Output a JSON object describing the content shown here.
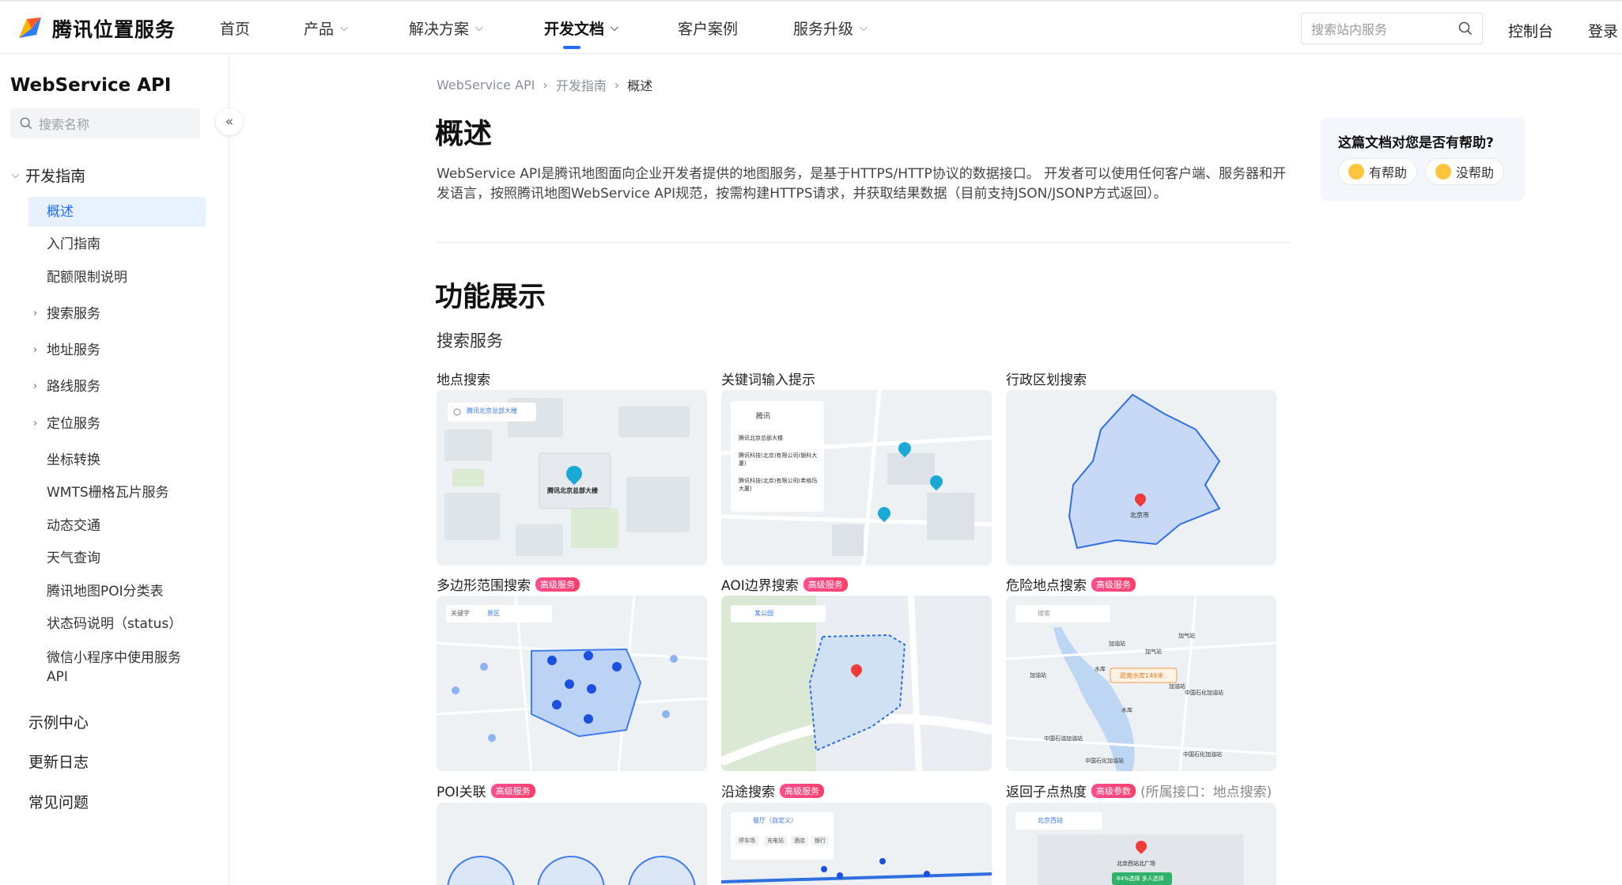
{
  "brand": {
    "name": "腾讯位置服务"
  },
  "nav": {
    "items": [
      {
        "label": "首页",
        "dropdown": false
      },
      {
        "label": "产品",
        "dropdown": true
      },
      {
        "label": "解决方案",
        "dropdown": true
      },
      {
        "label": "开发文档",
        "dropdown": true,
        "active": true
      },
      {
        "label": "客户案例",
        "dropdown": false
      },
      {
        "label": "服务升级",
        "dropdown": true
      }
    ],
    "search_placeholder": "搜索站内服务",
    "console": "控制台",
    "login": "登录"
  },
  "sidebar": {
    "title": "WebService API",
    "search_placeholder": "搜索名称",
    "group": "开发指南",
    "items": [
      {
        "label": "概述",
        "active": true
      },
      {
        "label": "入门指南"
      },
      {
        "label": "配额限制说明"
      },
      {
        "label": "搜索服务",
        "expandable": true
      },
      {
        "label": "地址服务",
        "expandable": true
      },
      {
        "label": "路线服务",
        "expandable": true
      },
      {
        "label": "定位服务",
        "expandable": true
      },
      {
        "label": "坐标转换"
      },
      {
        "label": "WMTS栅格瓦片服务"
      },
      {
        "label": "动态交通"
      },
      {
        "label": "天气查询"
      },
      {
        "label": "腾讯地图POI分类表"
      },
      {
        "label": "状态码说明（status）"
      },
      {
        "label": "微信小程序中使用服务API"
      }
    ],
    "top_links": [
      "示例中心",
      "更新日志",
      "常见问题"
    ]
  },
  "breadcrumb": [
    "WebService API",
    "开发指南",
    "概述"
  ],
  "page": {
    "title": "概述",
    "intro": "WebService API是腾讯地图面向企业开发者提供的地图服务，是基于HTTPS/HTTP协议的数据接口。 开发者可以使用任何客户端、服务器和开发语言，按照腾讯地图WebService API规范，按需构建HTTPS请求，并获取结果数据（目前支持JSON/JSONP方式返回）。",
    "section_title": "功能展示",
    "subsection": "搜索服务"
  },
  "cards": [
    {
      "title": "地点搜索",
      "search_text": "腾讯北京总部大楼",
      "pin_label": "腾讯北京总部大楼"
    },
    {
      "title": "关键词输入提示",
      "search_text": "腾讯",
      "suggestions": [
        "腾讯北京总部大楼",
        "腾讯科技(北京)有限公司(银科大厦)",
        "腾讯科技(北京)有限公司(希格玛大厦)"
      ]
    },
    {
      "title": "行政区划搜索",
      "pin_label": "北京市"
    },
    {
      "title": "多边形范围搜索",
      "badge": "高级服务",
      "search_label": "关键字",
      "search_text": "景区"
    },
    {
      "title": "AOI边界搜索",
      "badge": "高级服务",
      "search_text": "某公园"
    },
    {
      "title": "危险地点搜索",
      "badge": "高级服务",
      "search_text": "搜索",
      "warning": "距离水库149米",
      "labels": [
        "加油站",
        "加气站",
        "加油站",
        "加气站",
        "加油站",
        "中国石化加油站",
        "中国石油加油站",
        "中国石化加油站",
        "中国石化加油站",
        "水库",
        "水库"
      ]
    },
    {
      "title": "POI关联",
      "badge": "高级服务"
    },
    {
      "title": "沿途搜索",
      "badge": "高级服务",
      "search_text": "餐厅（自定义）",
      "filters": [
        "停车场",
        "充电站",
        "酒店",
        "银行"
      ]
    },
    {
      "title": "返回子点热度",
      "badge": "高级参数",
      "sub": "(所属接口：地点搜索)",
      "search_text": "北京西站",
      "pin_label": "北京西站北广场",
      "heat": "64%选择 多人选择"
    }
  ],
  "feedback": {
    "question": "这篇文档对您是否有帮助?",
    "yes": "有帮助",
    "no": "没帮助"
  }
}
